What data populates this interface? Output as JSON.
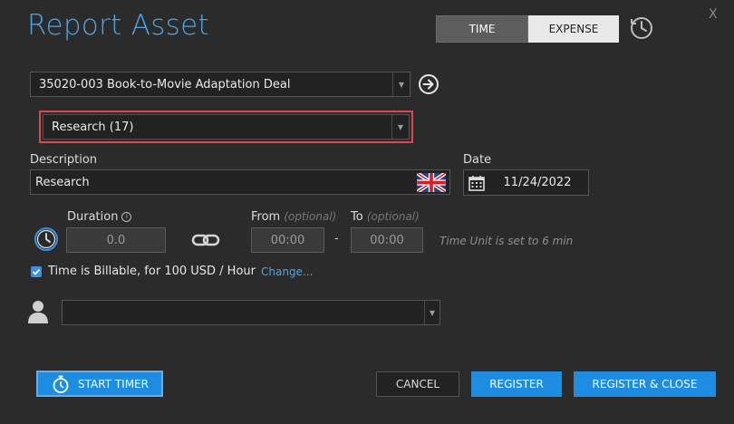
{
  "window": {
    "title": "Report Asset",
    "close_glyph": "X"
  },
  "tabs": [
    {
      "label": "TIME",
      "active": true
    },
    {
      "label": "EXPENSE",
      "active": false
    }
  ],
  "icons": {
    "history": "history-clock-icon",
    "go": "arrow-right-circle-icon",
    "flag": "uk-flag-icon",
    "calendar": "calendar-icon",
    "clock": "clock-icon",
    "link": "chain-link-icon",
    "person": "person-icon",
    "stopwatch": "stopwatch-icon"
  },
  "project": {
    "value": "35020-003 Book-to-Movie Adaptation Deal"
  },
  "activity": {
    "value": "Research (17)"
  },
  "description": {
    "label": "Description",
    "value": "Research"
  },
  "date": {
    "label": "Date",
    "value": "11/24/2022"
  },
  "duration": {
    "label": "Duration",
    "value": "0.0"
  },
  "from": {
    "label": "From",
    "optional": "(optional)",
    "value": "00:00"
  },
  "to": {
    "label": "To",
    "optional": "(optional)",
    "value": "00:00"
  },
  "separator": "-",
  "unit_note": "Time Unit is set to 6 min",
  "billable": {
    "checked": true,
    "text": "Time is Billable, for 100 USD / Hour",
    "change_link": "Change..."
  },
  "person": {
    "value": ""
  },
  "buttons": {
    "start_timer": "START TIMER",
    "cancel": "CANCEL",
    "register": "REGISTER",
    "register_close": "REGISTER & CLOSE"
  },
  "colors": {
    "accent": "#1e8ce0",
    "title": "#4ea4e6",
    "highlight_border": "#e0474c",
    "background": "#2b2b2b"
  }
}
